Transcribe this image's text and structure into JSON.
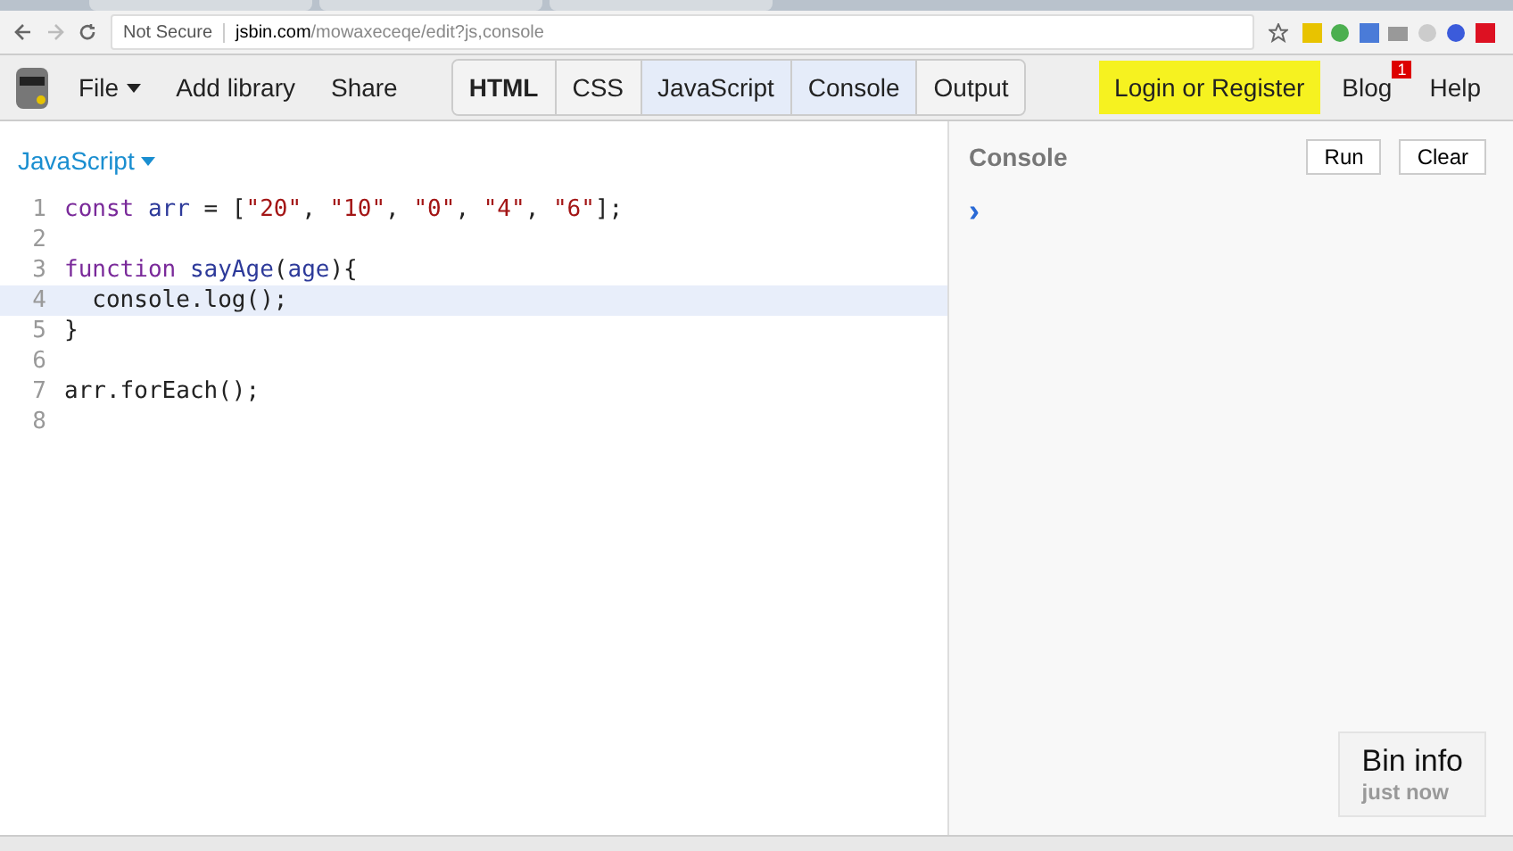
{
  "browser": {
    "security": "Not Secure",
    "url_host": "jsbin.com",
    "url_path": "/mowaxeceqe/edit?js,console"
  },
  "menu": [
    {
      "label": "File",
      "dropdown": true
    },
    {
      "label": "Add library",
      "dropdown": false
    },
    {
      "label": "Share",
      "dropdown": false
    }
  ],
  "panel_tabs": [
    {
      "label": "HTML",
      "selected": false,
      "bold": true
    },
    {
      "label": "CSS",
      "selected": false,
      "bold": false
    },
    {
      "label": "JavaScript",
      "selected": true,
      "bold": false
    },
    {
      "label": "Console",
      "selected": true,
      "bold": false
    },
    {
      "label": "Output",
      "selected": false,
      "bold": false
    }
  ],
  "login": "Login or Register",
  "blog": {
    "label": "Blog",
    "badge": "1"
  },
  "help": "Help",
  "editor": {
    "language": "JavaScript",
    "lines": [
      {
        "number": "1",
        "active": false,
        "tokens": [
          {
            "kind": "keyword",
            "text": "const"
          },
          {
            "kind": "variable",
            "text": " arr"
          },
          {
            "kind": "plain",
            "text": " = ["
          },
          {
            "kind": "string",
            "text": "\"20\""
          },
          {
            "kind": "plain",
            "text": ", "
          },
          {
            "kind": "string",
            "text": "\"10\""
          },
          {
            "kind": "plain",
            "text": ", "
          },
          {
            "kind": "string",
            "text": "\"0\""
          },
          {
            "kind": "plain",
            "text": ", "
          },
          {
            "kind": "string",
            "text": "\"4\""
          },
          {
            "kind": "plain",
            "text": ", "
          },
          {
            "kind": "string",
            "text": "\"6\""
          },
          {
            "kind": "plain",
            "text": "];"
          }
        ]
      },
      {
        "number": "2",
        "active": false
      },
      {
        "number": "3",
        "active": false,
        "tokens": [
          {
            "kind": "keyword",
            "text": "function"
          },
          {
            "kind": "variable",
            "text": " sayAge"
          },
          {
            "kind": "plain",
            "text": "("
          },
          {
            "kind": "variable",
            "text": "age"
          },
          {
            "kind": "plain",
            "text": "){"
          }
        ]
      },
      {
        "number": "4",
        "active": true,
        "tokens": [
          {
            "kind": "plain",
            "text": "  console.log();"
          }
        ]
      },
      {
        "number": "5",
        "active": false,
        "tokens": [
          {
            "kind": "plain",
            "text": "}"
          }
        ]
      },
      {
        "number": "6",
        "active": false
      },
      {
        "number": "7",
        "active": false,
        "tokens": [
          {
            "kind": "plain",
            "text": "arr.forEach();"
          }
        ]
      },
      {
        "number": "8",
        "active": false
      }
    ]
  },
  "console": {
    "title": "Console",
    "buttons": [
      "Run",
      "Clear"
    ],
    "prompt": "›"
  },
  "bin_info": {
    "title": "Bin info",
    "time": "just now"
  }
}
